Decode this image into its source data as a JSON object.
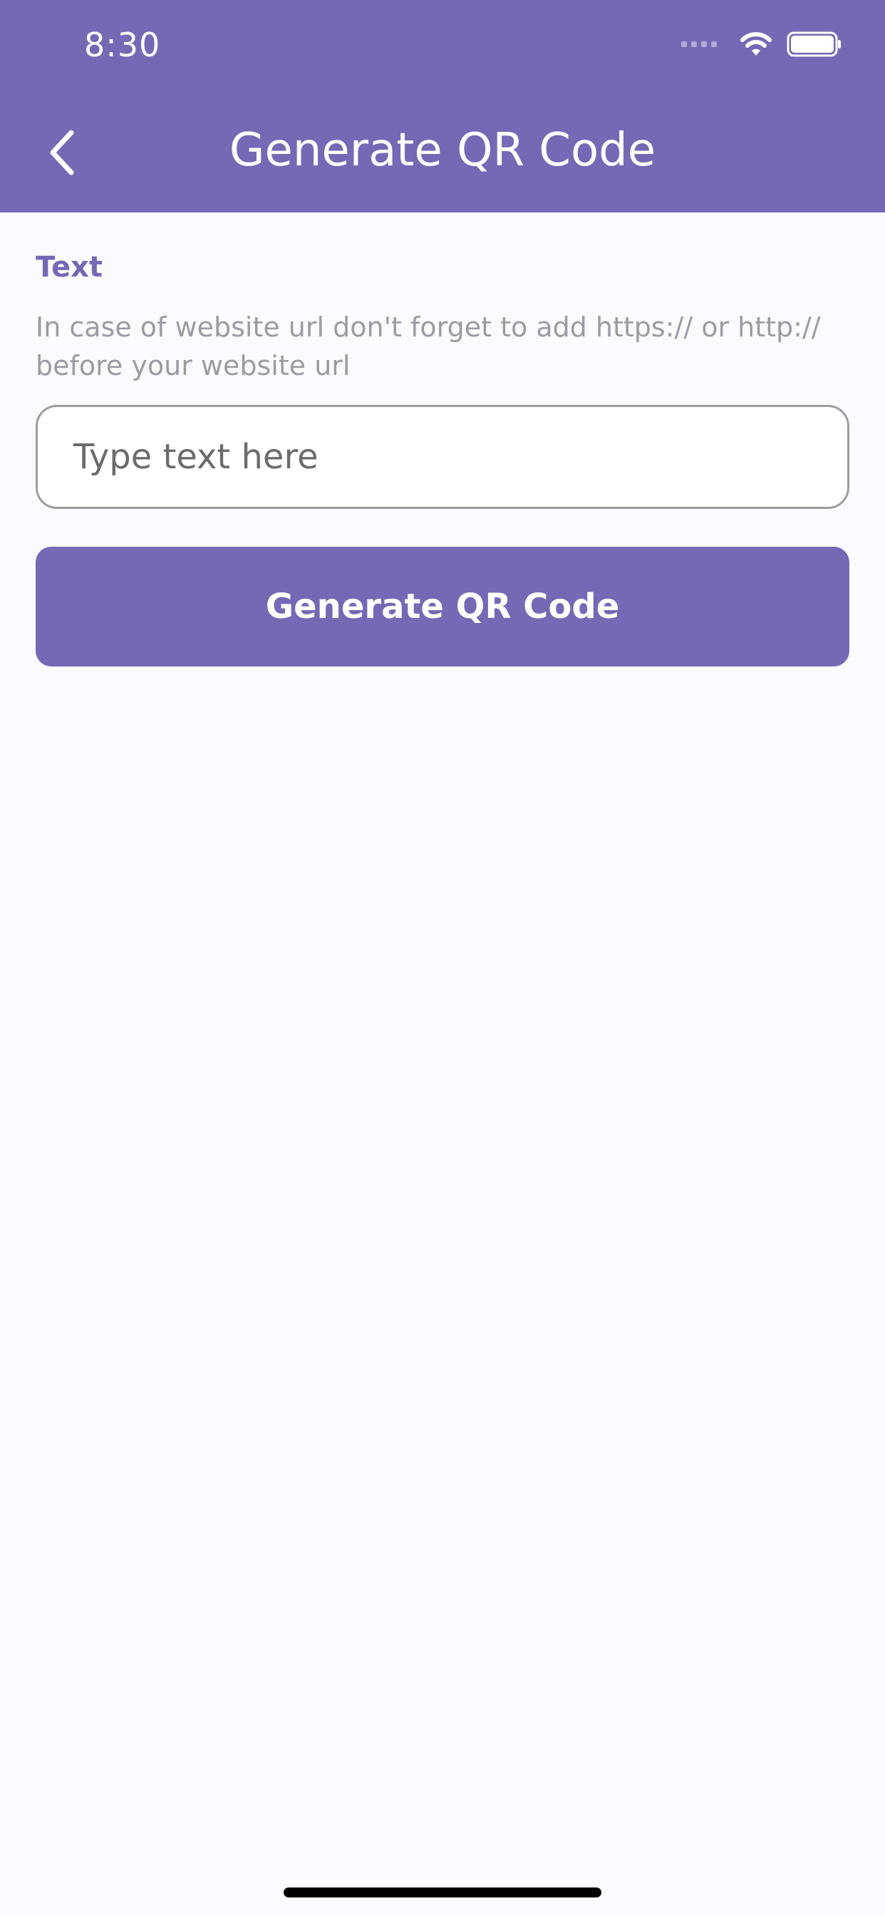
{
  "status_bar": {
    "time": "8:30"
  },
  "app_bar": {
    "title": "Generate QR Code",
    "back_icon": "chevron-left-icon"
  },
  "form": {
    "label": "Text",
    "hint": "In case of website url don't forget to add https:// or http:// before your website url",
    "input_value": "",
    "input_placeholder": "Type text here",
    "button_label": "Generate QR Code"
  },
  "colors": {
    "primary": "#7569b5",
    "background": "#fdfaff",
    "hint_text": "#9c9aa3",
    "input_border": "#9d9d9d"
  }
}
